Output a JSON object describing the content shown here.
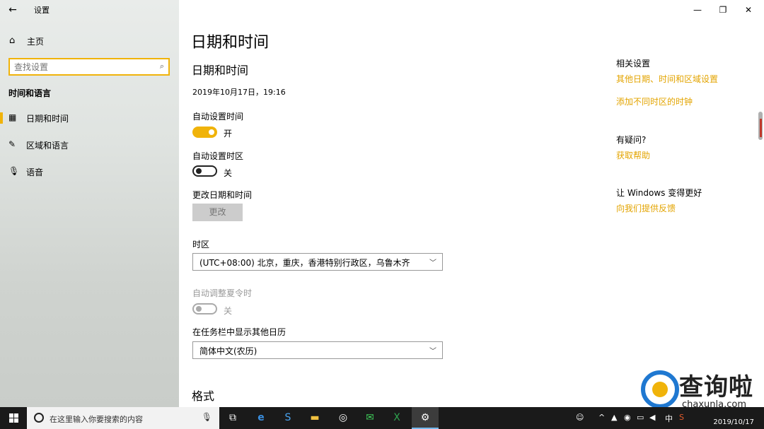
{
  "app": {
    "title": "设置"
  },
  "sidebar": {
    "home_label": "主页",
    "search_placeholder": "查找设置",
    "section_label": "时间和语言",
    "items": [
      {
        "label": "日期和时间",
        "icon": "calendar-clock-icon",
        "selected": true
      },
      {
        "label": "区域和语言",
        "icon": "region-language-icon",
        "selected": false
      },
      {
        "label": "语音",
        "icon": "microphone-icon",
        "selected": false
      }
    ]
  },
  "main": {
    "page_title": "日期和时间",
    "section_title": "日期和时间",
    "current_datetime": "2019年10月17日，19:16",
    "auto_time": {
      "label": "自动设置时间",
      "state_text": "开",
      "on": true
    },
    "auto_timezone": {
      "label": "自动设置时区",
      "state_text": "关",
      "on": false
    },
    "change_datetime": {
      "label": "更改日期和时间",
      "button_label": "更改"
    },
    "timezone": {
      "label": "时区",
      "value": "(UTC+08:00) 北京，重庆，香港特别行政区，乌鲁木齐"
    },
    "dst": {
      "label": "自动调整夏令时",
      "state_text": "关",
      "on": false,
      "disabled": true
    },
    "calendar": {
      "label": "在任务栏中显示其他日历",
      "value": "简体中文(农历)"
    },
    "format_title": "格式"
  },
  "related": {
    "title": "相关设置",
    "links": [
      "其他日期、时间和区域设置",
      "添加不同时区的时钟"
    ],
    "help_title": "有疑问?",
    "help_link": "获取帮助",
    "improve_title": "让 Windows 变得更好",
    "feedback_link": "向我们提供反馈"
  },
  "watermark": {
    "text": "查询啦",
    "sub": "chaxunla.com"
  },
  "taskbar": {
    "search_placeholder": "在这里输入你要搜索的内容",
    "ime": "中",
    "date": "2019/10/17"
  },
  "colors": {
    "accent": "#f0b30a",
    "link": "#e3a400",
    "taskbar": "#1a1a1a"
  }
}
